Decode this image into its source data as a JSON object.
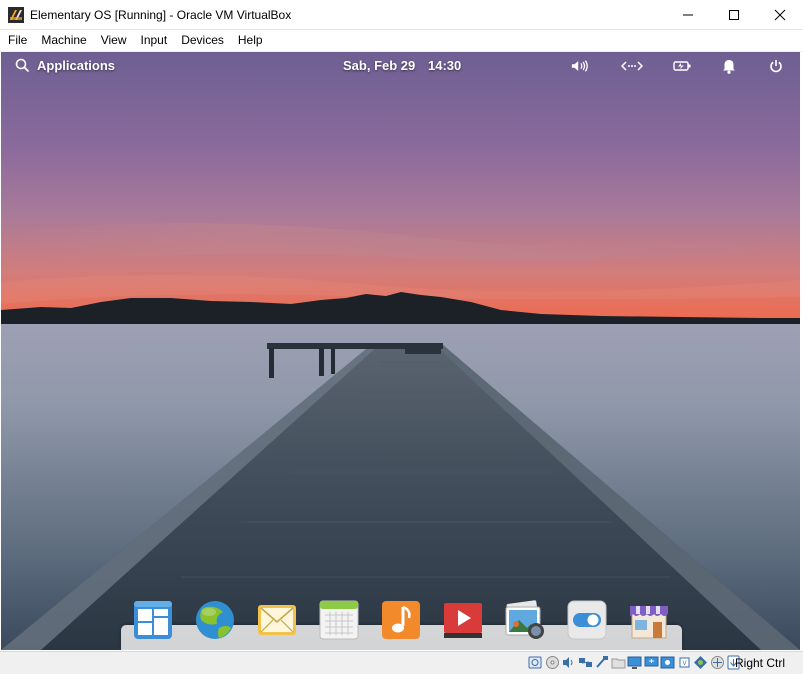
{
  "window": {
    "title": "Elementary OS [Running] - Oracle VM VirtualBox",
    "minimize_icon": "minimize-icon",
    "maximize_icon": "maximize-icon",
    "close_icon": "close-icon"
  },
  "menubar": {
    "items": [
      {
        "label": "File"
      },
      {
        "label": "Machine"
      },
      {
        "label": "View"
      },
      {
        "label": "Input"
      },
      {
        "label": "Devices"
      },
      {
        "label": "Help"
      }
    ]
  },
  "guest": {
    "panel": {
      "applications_label": "Applications",
      "date": "Sab, Feb 29",
      "time": "14:30",
      "indicators": [
        "sound-icon",
        "network-icon",
        "battery-icon",
        "notifications-icon",
        "power-icon"
      ]
    },
    "dock": {
      "apps": [
        {
          "name": "multitasking-view-icon"
        },
        {
          "name": "web-browser-icon"
        },
        {
          "name": "mail-icon"
        },
        {
          "name": "calendar-icon"
        },
        {
          "name": "music-icon"
        },
        {
          "name": "videos-icon"
        },
        {
          "name": "photos-icon"
        },
        {
          "name": "system-settings-icon"
        },
        {
          "name": "appcenter-icon"
        }
      ]
    }
  },
  "statusbar": {
    "host_key": "Right Ctrl",
    "icons": [
      "hard-disk-icon",
      "optical-drive-icon",
      "audio-icon",
      "network-adapter-icon",
      "usb-icon",
      "shared-folders-icon",
      "display-icon",
      "screen-capture-icon",
      "recording-icon",
      "cpu-icon",
      "virtualization-icon",
      "mouse-integration-icon",
      "keyboard-capture-icon"
    ]
  },
  "colors": {
    "sky_top": "#6e5f93",
    "sky_mid": "#a07698",
    "sky_glow": "#e8725c",
    "water": "#8e98a8",
    "pier": "#3a4754"
  }
}
